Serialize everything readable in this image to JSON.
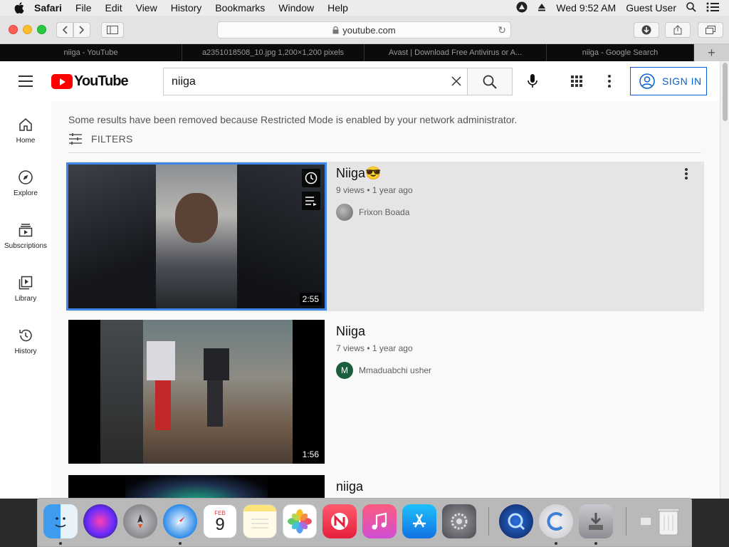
{
  "menubar": {
    "app": "Safari",
    "items": [
      "File",
      "Edit",
      "View",
      "History",
      "Bookmarks",
      "Window",
      "Help"
    ],
    "clock": "Wed 9:52 AM",
    "user": "Guest User"
  },
  "safari": {
    "url": "youtube.com",
    "tabs": [
      "niiga - YouTube",
      "a2351018508_10.jpg 1,200×1,200 pixels",
      "Avast | Download Free Antivirus or A...",
      "niiga - Google Search"
    ]
  },
  "youtube": {
    "logo": "YouTube",
    "search_value": "niiga",
    "signin_label": "SIGN IN",
    "guide": [
      {
        "label": "Home",
        "icon": "home-icon"
      },
      {
        "label": "Explore",
        "icon": "compass-icon"
      },
      {
        "label": "Subscriptions",
        "icon": "subscriptions-icon"
      },
      {
        "label": "Library",
        "icon": "library-icon"
      },
      {
        "label": "History",
        "icon": "history-icon"
      }
    ],
    "notice": "Some results have been removed because Restricted Mode is enabled by your network administrator.",
    "filters_label": "FILTERS",
    "results": [
      {
        "title": "Niiga😎",
        "views": "9 views",
        "age": "1 year ago",
        "channel": "Frixon Boada",
        "duration": "2:55"
      },
      {
        "title": "Niiga",
        "views": "7 views",
        "age": "1 year ago",
        "channel": "Mmaduabchi usher",
        "avatar_letter": "M",
        "duration": "1:56"
      },
      {
        "title": "niiga"
      }
    ]
  },
  "dock": {
    "calendar_month": "FEB",
    "calendar_day": "9"
  },
  "colors": {
    "youtube_red": "#ff0000",
    "signin_blue": "#065fd4",
    "selection_blue": "#3e86e8"
  }
}
